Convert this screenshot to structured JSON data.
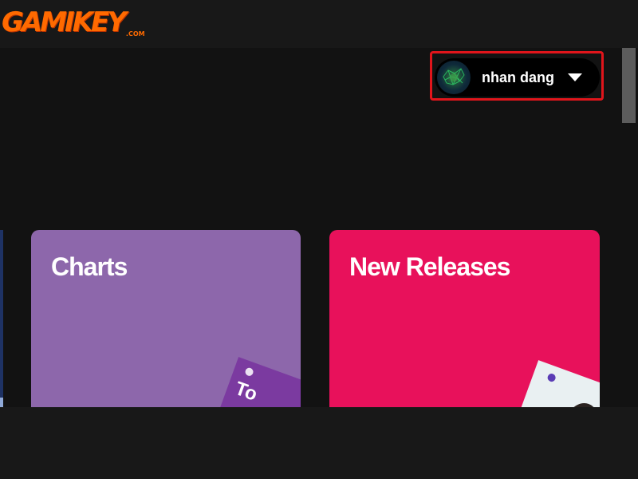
{
  "header": {
    "logo_text": "GAMIKEY",
    "logo_suffix": ".COM"
  },
  "user_menu": {
    "name": "nhan dang"
  },
  "cards": [
    {
      "title": "Charts",
      "color": "#8d67ab"
    },
    {
      "title": "New Releases",
      "color": "#e8115b"
    }
  ],
  "card_art": {
    "charts_text": "To"
  },
  "colors": {
    "highlight": "#e0151b",
    "background": "#121212"
  },
  "icons": {
    "avatar": "avatar-image",
    "dropdown": "chevron-down-icon",
    "spotify": "spotify-icon"
  }
}
